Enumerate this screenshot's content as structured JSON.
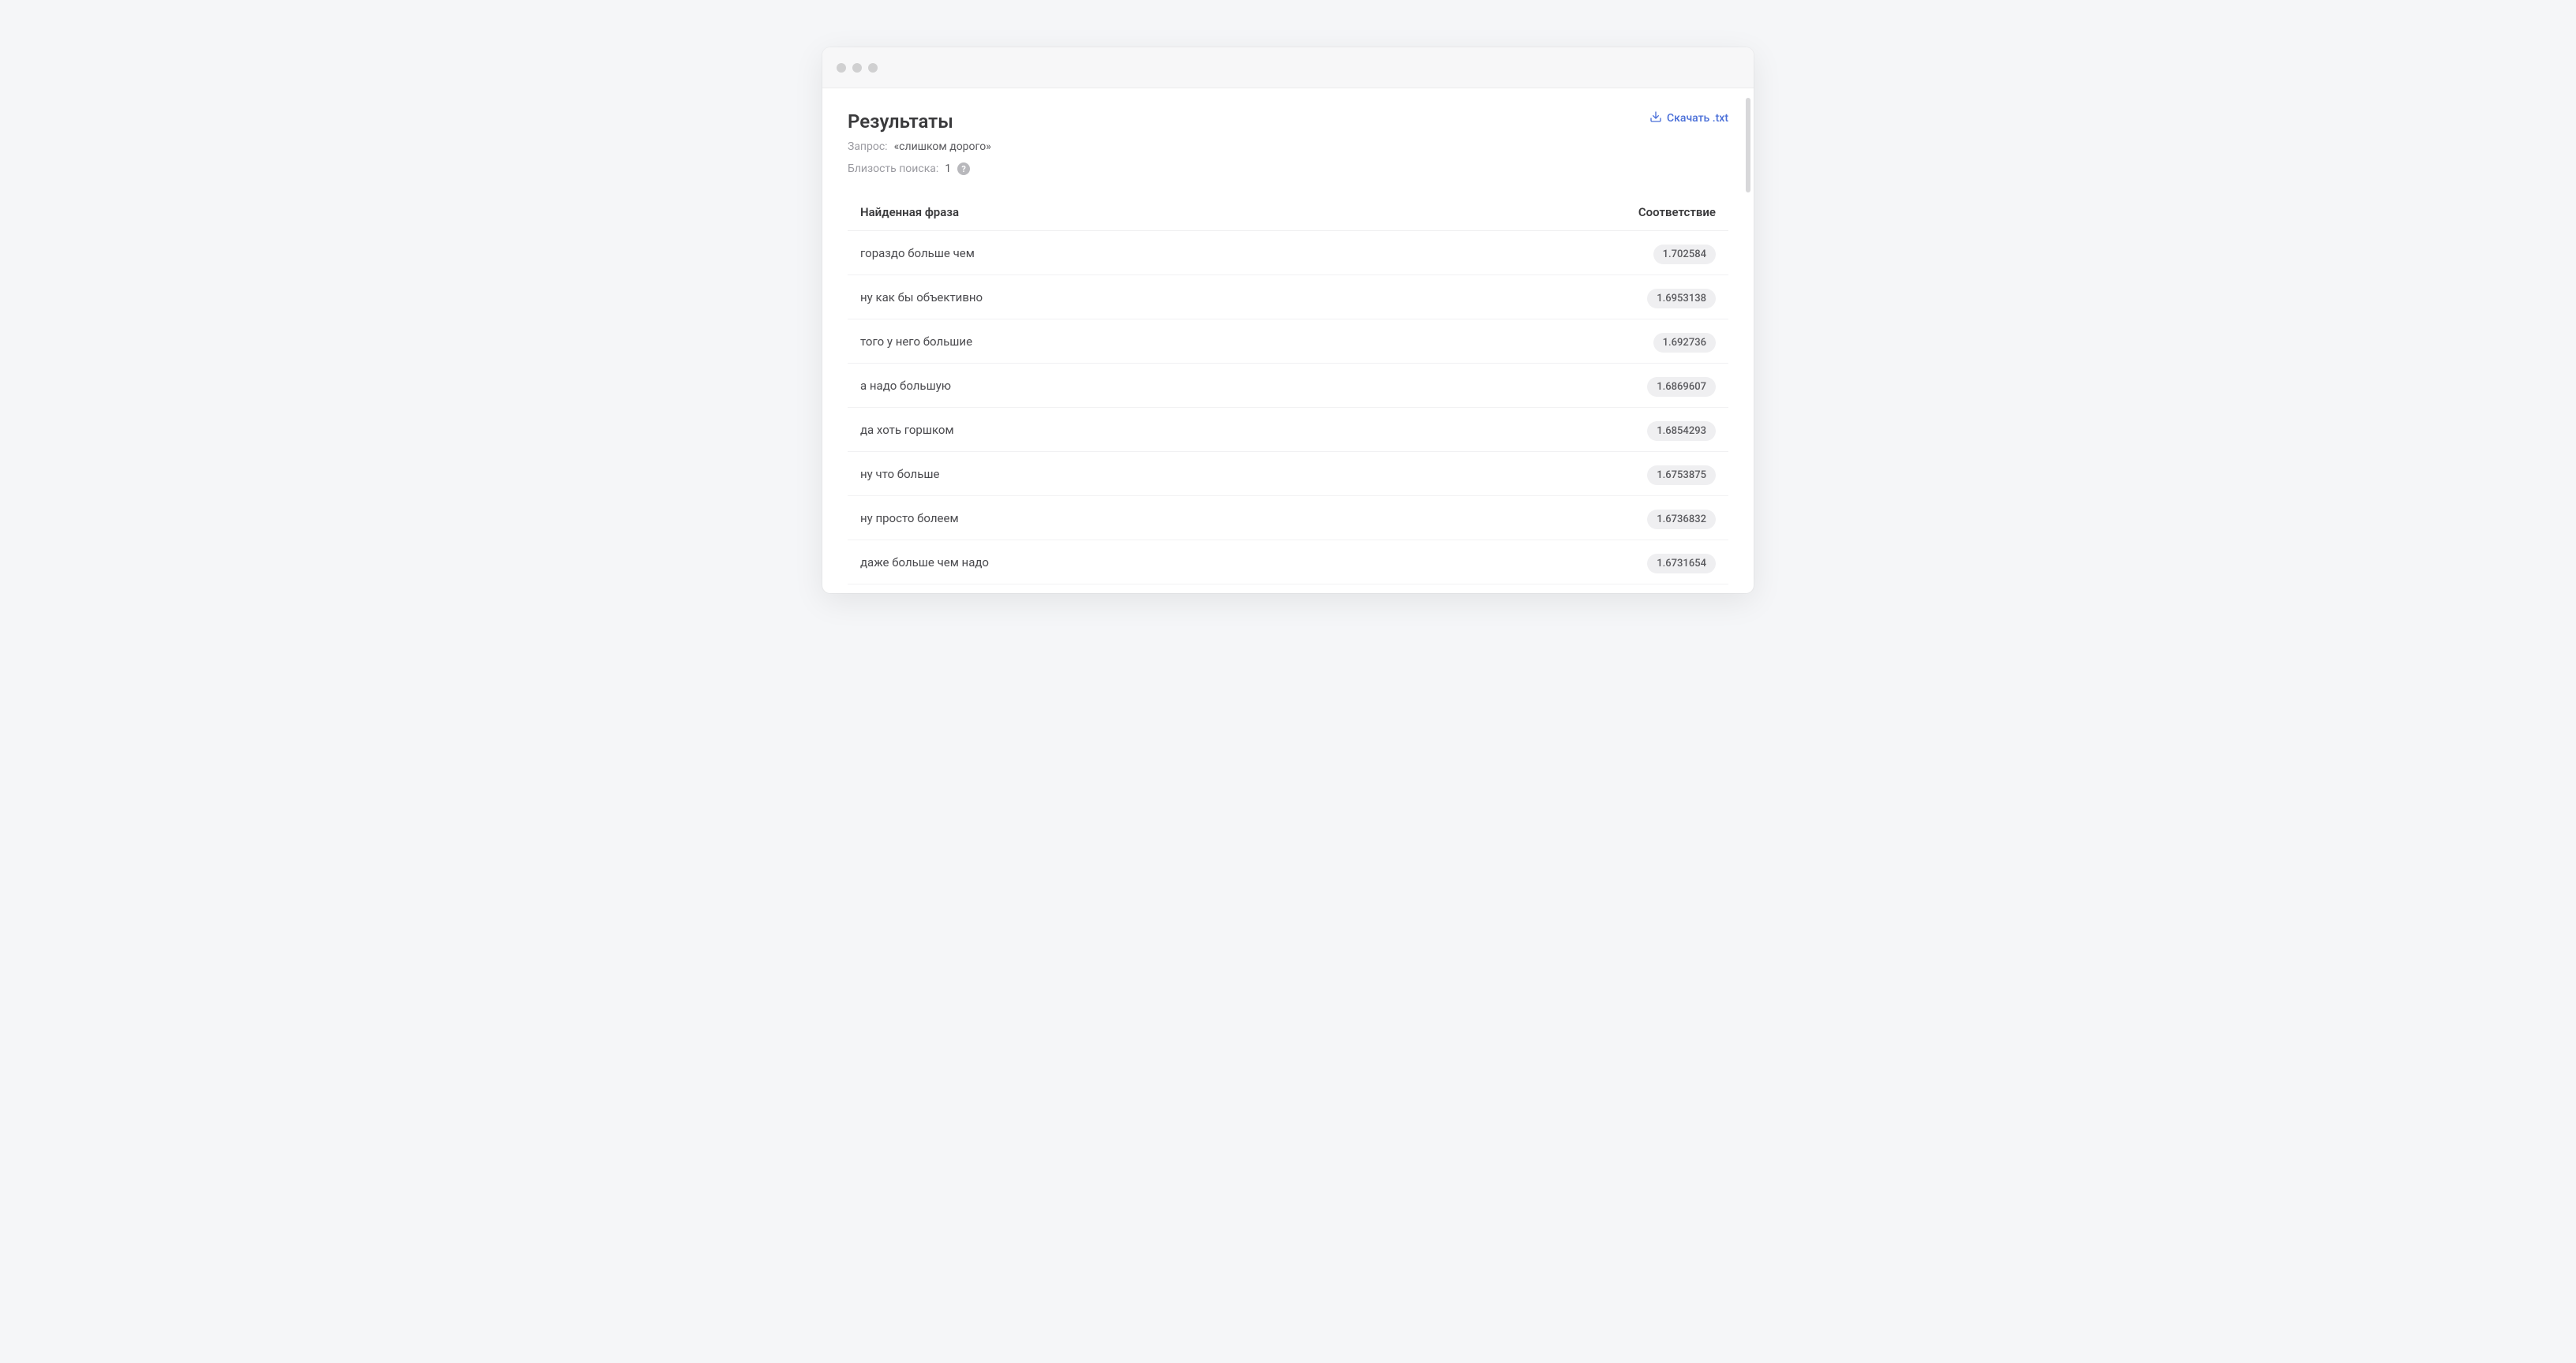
{
  "header": {
    "title": "Результаты",
    "download_label": "Скачать .txt"
  },
  "meta": {
    "query_label": "Запрос:",
    "query_value": "«слишком дорого»",
    "proximity_label": "Близость поиска:",
    "proximity_value": "1"
  },
  "table": {
    "col_phrase": "Найденная фраза",
    "col_score": "Соответствие",
    "rows": [
      {
        "phrase": "гораздо больше чем",
        "score": "1.702584"
      },
      {
        "phrase": "ну как бы объективно",
        "score": "1.6953138"
      },
      {
        "phrase": "того у него большие",
        "score": "1.692736"
      },
      {
        "phrase": "а надо большую",
        "score": "1.6869607"
      },
      {
        "phrase": "да хоть горшком",
        "score": "1.6854293"
      },
      {
        "phrase": "ну что больше",
        "score": "1.6753875"
      },
      {
        "phrase": "ну просто болеем",
        "score": "1.6736832"
      },
      {
        "phrase": "даже больше чем надо",
        "score": "1.6731654"
      }
    ]
  }
}
